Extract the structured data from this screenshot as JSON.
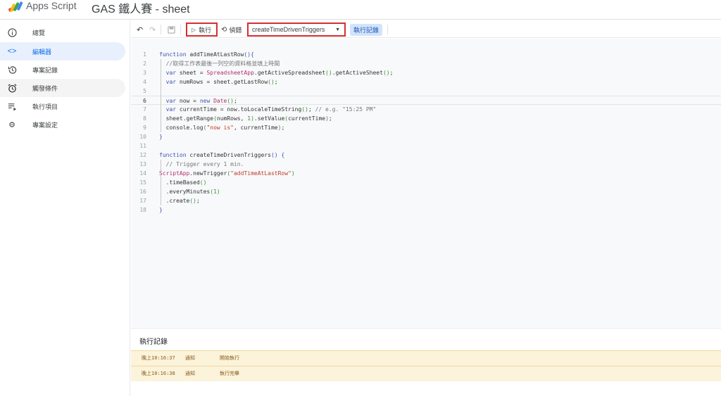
{
  "header": {
    "app_name": "Apps Script",
    "project_title": "GAS 鐵人賽 - sheet"
  },
  "sidebar": {
    "items": [
      {
        "label": "總覽",
        "icon": "info-icon"
      },
      {
        "label": "編輯器",
        "icon": "code-icon",
        "active": true
      },
      {
        "label": "專案記錄",
        "icon": "history-icon"
      },
      {
        "label": "觸發條件",
        "icon": "alarm-icon"
      },
      {
        "label": "執行項目",
        "icon": "list-play-icon"
      },
      {
        "label": "專案設定",
        "icon": "gear-icon"
      }
    ]
  },
  "toolbar": {
    "run_label": "執行",
    "debug_label": "偵錯",
    "function_select": "createTimeDrivenTriggers",
    "log_label": "執行記錄",
    "highlight_color": "#d32f2f"
  },
  "editor": {
    "current_line": 6,
    "lines": [
      [
        [
          "k",
          "function"
        ],
        [
          "t",
          " addTimeAtLastRow"
        ],
        [
          "b",
          "(){"
        ]
      ],
      [
        [
          "c",
          "  //取得工作表最後一列空的資料格並填上時間"
        ]
      ],
      [
        [
          "t",
          "  "
        ],
        [
          "k",
          "var"
        ],
        [
          "t",
          " sheet = "
        ],
        [
          "f",
          "SpreadsheetApp"
        ],
        [
          "t",
          ".getActiveSpreadsheet"
        ],
        [
          "p",
          "()"
        ],
        [
          "t",
          ".getActiveSheet"
        ],
        [
          "p",
          "()"
        ],
        [
          "t",
          ";"
        ]
      ],
      [
        [
          "t",
          "  "
        ],
        [
          "k",
          "var"
        ],
        [
          "t",
          " numRows = sheet.getLastRow"
        ],
        [
          "p",
          "()"
        ],
        [
          "t",
          ";"
        ]
      ],
      [],
      [
        [
          "t",
          "  "
        ],
        [
          "k",
          "var"
        ],
        [
          "t",
          " now = "
        ],
        [
          "k",
          "new"
        ],
        [
          "t",
          " "
        ],
        [
          "f",
          "Date"
        ],
        [
          "p",
          "()"
        ],
        [
          "t",
          ";"
        ]
      ],
      [
        [
          "t",
          "  "
        ],
        [
          "k",
          "var"
        ],
        [
          "t",
          " currentTime = now.toLocaleTimeString"
        ],
        [
          "p",
          "()"
        ],
        [
          "t",
          "; "
        ],
        [
          "c",
          "// e.g. \"15:25 PM\""
        ]
      ],
      [
        [
          "t",
          "  sheet.getRange"
        ],
        [
          "p",
          "("
        ],
        [
          "t",
          "numRows, "
        ],
        [
          "n",
          "1"
        ],
        [
          "p",
          ")"
        ],
        [
          "t",
          ".setValue"
        ],
        [
          "p",
          "("
        ],
        [
          "t",
          "currentTime"
        ],
        [
          "p",
          ")"
        ],
        [
          "t",
          ";"
        ]
      ],
      [
        [
          "t",
          "  console.log"
        ],
        [
          "p",
          "("
        ],
        [
          "s",
          "\"now is\""
        ],
        [
          "t",
          ", currentTime"
        ],
        [
          "p",
          ")"
        ],
        [
          "t",
          ";"
        ]
      ],
      [
        [
          "b",
          "}"
        ]
      ],
      [],
      [
        [
          "k",
          "function"
        ],
        [
          "t",
          " createTimeDrivenTriggers"
        ],
        [
          "b",
          "()"
        ],
        [
          "t",
          " "
        ],
        [
          "b",
          "{"
        ]
      ],
      [
        [
          "c",
          "  // Trigger every 1 min."
        ]
      ],
      [
        [
          "f",
          "ScriptApp"
        ],
        [
          "t",
          ".newTrigger"
        ],
        [
          "p",
          "("
        ],
        [
          "s",
          "\"addTimeAtLastRow\""
        ],
        [
          "p",
          ")"
        ]
      ],
      [
        [
          "t",
          "  .timeBased"
        ],
        [
          "p",
          "()"
        ]
      ],
      [
        [
          "t",
          "  .everyMinutes"
        ],
        [
          "p",
          "("
        ],
        [
          "n",
          "1"
        ],
        [
          "p",
          ")"
        ]
      ],
      [
        [
          "t",
          "  .create"
        ],
        [
          "p",
          "()"
        ],
        [
          "t",
          ";"
        ]
      ],
      [
        [
          "b",
          "}"
        ]
      ]
    ]
  },
  "log_panel": {
    "title": "執行記錄",
    "rows": [
      {
        "time": "晚上10:16:37",
        "level": "通知",
        "message": "開始執行"
      },
      {
        "time": "晚上10:16:38",
        "level": "通知",
        "message": "執行完畢"
      }
    ]
  }
}
